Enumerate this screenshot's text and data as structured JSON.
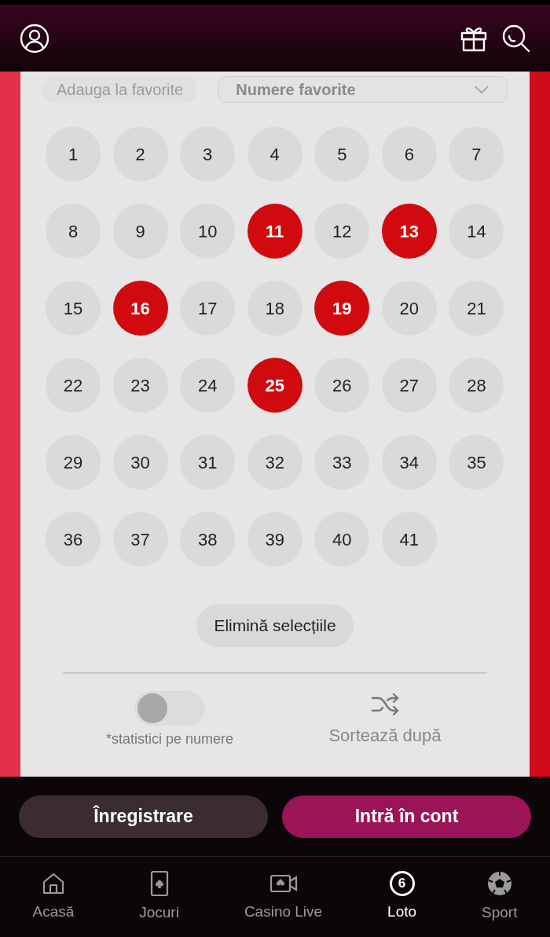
{
  "favorites": {
    "add_label": "Adauga la favorite",
    "dropdown_label": "Numere favorite"
  },
  "numbers": [
    {
      "label": "1",
      "selected": false
    },
    {
      "label": "2",
      "selected": false
    },
    {
      "label": "3",
      "selected": false
    },
    {
      "label": "4",
      "selected": false
    },
    {
      "label": "5",
      "selected": false
    },
    {
      "label": "6",
      "selected": false
    },
    {
      "label": "7",
      "selected": false
    },
    {
      "label": "8",
      "selected": false
    },
    {
      "label": "9",
      "selected": false
    },
    {
      "label": "10",
      "selected": false
    },
    {
      "label": "11",
      "selected": true
    },
    {
      "label": "12",
      "selected": false
    },
    {
      "label": "13",
      "selected": true
    },
    {
      "label": "14",
      "selected": false
    },
    {
      "label": "15",
      "selected": false
    },
    {
      "label": "16",
      "selected": true
    },
    {
      "label": "17",
      "selected": false
    },
    {
      "label": "18",
      "selected": false
    },
    {
      "label": "19",
      "selected": true
    },
    {
      "label": "20",
      "selected": false
    },
    {
      "label": "21",
      "selected": false
    },
    {
      "label": "22",
      "selected": false
    },
    {
      "label": "23",
      "selected": false
    },
    {
      "label": "24",
      "selected": false
    },
    {
      "label": "25",
      "selected": true
    },
    {
      "label": "26",
      "selected": false
    },
    {
      "label": "27",
      "selected": false
    },
    {
      "label": "28",
      "selected": false
    },
    {
      "label": "29",
      "selected": false
    },
    {
      "label": "30",
      "selected": false
    },
    {
      "label": "31",
      "selected": false
    },
    {
      "label": "32",
      "selected": false
    },
    {
      "label": "33",
      "selected": false
    },
    {
      "label": "34",
      "selected": false
    },
    {
      "label": "35",
      "selected": false
    },
    {
      "label": "36",
      "selected": false
    },
    {
      "label": "37",
      "selected": false
    },
    {
      "label": "38",
      "selected": false
    },
    {
      "label": "39",
      "selected": false
    },
    {
      "label": "40",
      "selected": false
    },
    {
      "label": "41",
      "selected": false
    }
  ],
  "clear_button": "Elimină selecțiile",
  "statistics": {
    "on": false,
    "label": "*statistici pe numere"
  },
  "sort": {
    "label": "Sortează după"
  },
  "auth": {
    "register": "Înregistrare",
    "login": "Intră în cont"
  },
  "nav": [
    {
      "kind": "home",
      "label": "Acasă",
      "selected": false
    },
    {
      "kind": "cards",
      "label": "Jocuri",
      "selected": false
    },
    {
      "kind": "video",
      "label": "Casino Live",
      "selected": false
    },
    {
      "kind": "loto",
      "label": "Loto",
      "selected": true,
      "badge": "6"
    },
    {
      "kind": "ball",
      "label": "Sport",
      "selected": false
    }
  ]
}
